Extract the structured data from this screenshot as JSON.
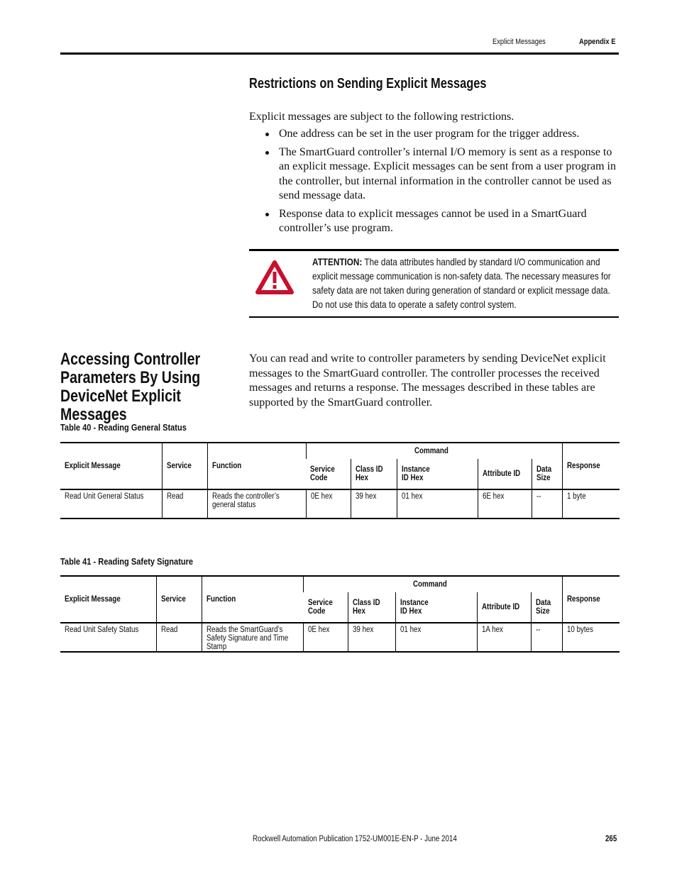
{
  "header": {
    "section": "Explicit Messages",
    "appendix": "Appendix E"
  },
  "restrictions": {
    "heading": "Restrictions on Sending Explicit Messages",
    "intro": "Explicit messages are subject to the following restrictions.",
    "bullets": [
      "One address can be set in the user program for the trigger address.",
      "The SmartGuard controller’s internal I/O memory is sent as a response to an explicit message. Explicit messages can be sent from a user program in the controller, but internal information in the controller cannot be used as send message data.",
      "Response data to explicit messages cannot be used in a SmartGuard controller’s use program."
    ]
  },
  "attention": {
    "icon": "warning-triangle-icon",
    "icon_color": "#c8102e",
    "label": "ATTENTION:",
    "text": " The data attributes handled by standard I/O communication and explicit message communication is non-safety data. The necessary measures for safety data are not taken during generation of standard or explicit message data. Do not use this data to operate a safety control system."
  },
  "accessing": {
    "heading": "Accessing Controller Parameters By Using DeviceNet Explicit Messages",
    "paragraph": "You can read and write to controller parameters by sending DeviceNet explicit messages to the SmartGuard controller. The controller processes the received messages and returns a response. The messages described in these tables are supported by the SmartGuard controller."
  },
  "columns": {
    "explicit_message": "Explicit Message",
    "service": "Service",
    "function": "Function",
    "command": "Command",
    "service_code": "Service Code",
    "class_id": "Class ID Hex",
    "instance_id": "Instance ID Hex",
    "attribute_id": "Attribute ID",
    "data_size": "Data Size",
    "response": "Response"
  },
  "tables": [
    {
      "caption": "Table 40 - Reading General Status",
      "rows": [
        {
          "explicit_message": "Read Unit General Status",
          "service": "Read",
          "function": "Reads the controller’s general status",
          "service_code": "0E hex",
          "class_id": "39 hex",
          "instance_id": "01 hex",
          "attribute_id": "6E hex",
          "data_size": "--",
          "response": "1 byte"
        }
      ]
    },
    {
      "caption": "Table 41 - Reading Safety Signature",
      "rows": [
        {
          "explicit_message": "Read Unit Safety Status",
          "service": "Read",
          "function": "Reads the SmartGuard’s Safety Signature and Time Stamp",
          "service_code": "0E hex",
          "class_id": "39 hex",
          "instance_id": "01 hex",
          "attribute_id": "1A hex",
          "data_size": "--",
          "response": "10 bytes"
        }
      ]
    }
  ],
  "footer": {
    "publication": "Rockwell Automation Publication 1752-UM001E-EN-P - June 2014",
    "page_number": "265"
  }
}
